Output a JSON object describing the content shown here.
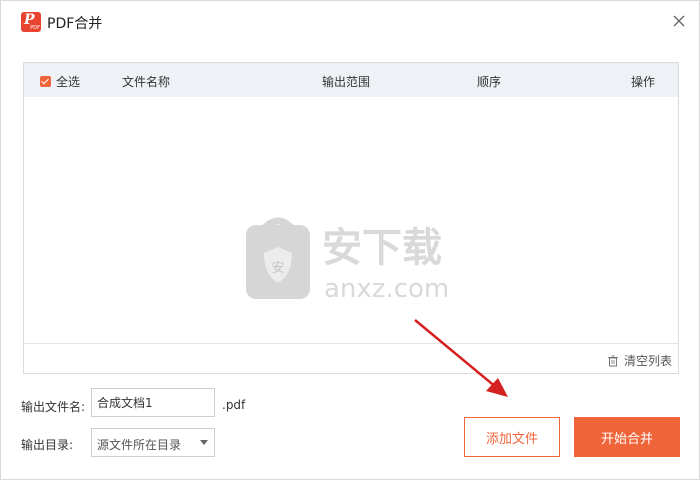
{
  "window": {
    "title": "PDF合并",
    "logo_text": "P",
    "logo_small_text": "PDF",
    "close_icon": "close-icon"
  },
  "table": {
    "select_all_label": "全选",
    "select_all_checked": true,
    "columns": [
      "文件名称",
      "输出范围",
      "顺序",
      "操作"
    ],
    "rows": [],
    "clear_list_label": "清空列表"
  },
  "watermark": {
    "brand_text": "安下载",
    "domain_text": "anxz.com",
    "badge_text": "安"
  },
  "output": {
    "filename_label": "输出文件名:",
    "filename_value": "合成文档1",
    "extension": ".pdf",
    "directory_label": "输出目录:",
    "directory_value": "源文件所在目录"
  },
  "buttons": {
    "add_file": "添加文件",
    "start_merge": "开始合并"
  },
  "colors": {
    "accent": "#f0643a",
    "header_bg": "#eef1f6",
    "annotation_arrow": "#d42020"
  }
}
